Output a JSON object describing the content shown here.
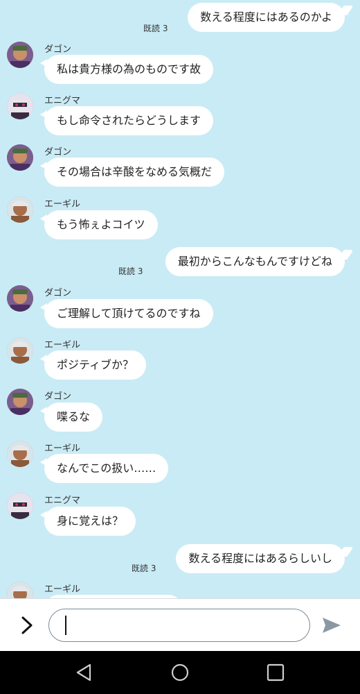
{
  "chat": {
    "messages": [
      {
        "type": "out",
        "text": "数える程度にはあるのかよ",
        "read": "既読 3"
      },
      {
        "type": "in",
        "name": "ダゴン",
        "avatar": "dagon",
        "text": "私は貴方様の為のものです故"
      },
      {
        "type": "in",
        "name": "エニグマ",
        "avatar": "enigma",
        "text": "もし命令されたらどうします"
      },
      {
        "type": "in",
        "name": "ダゴン",
        "avatar": "dagon",
        "text": "その場合は辛酸をなめる気概だ"
      },
      {
        "type": "in",
        "name": "エーギル",
        "avatar": "aegir",
        "text": "もう怖ぇよコイツ"
      },
      {
        "type": "out",
        "text": "最初からこんなもんですけどね",
        "read": "既読 3"
      },
      {
        "type": "in",
        "name": "ダゴン",
        "avatar": "dagon",
        "text": "ご理解して頂けてるのですね"
      },
      {
        "type": "in",
        "name": "エーギル",
        "avatar": "aegir",
        "text": "ポジティブか？"
      },
      {
        "type": "in",
        "name": "ダゴン",
        "avatar": "dagon",
        "text": "喋るな"
      },
      {
        "type": "in",
        "name": "エーギル",
        "avatar": "aegir",
        "text": "なんでこの扱い……"
      },
      {
        "type": "in",
        "name": "エニグマ",
        "avatar": "enigma",
        "text": "身に覚えは？"
      },
      {
        "type": "out",
        "text": "数える程度にはあるらしいし",
        "read": "既読 3"
      },
      {
        "type": "in",
        "name": "エーギル",
        "avatar": "aegir",
        "text": ""
      }
    ]
  },
  "input": {
    "value": "",
    "placeholder": ""
  },
  "icons": {
    "expand": "chevron-right-icon",
    "send": "send-icon",
    "back": "back-triangle-icon",
    "home": "home-circle-icon",
    "recents": "recents-square-icon"
  },
  "colors": {
    "background": "#c9ebf5",
    "bubble": "#ffffff",
    "navbar": "#000000"
  }
}
